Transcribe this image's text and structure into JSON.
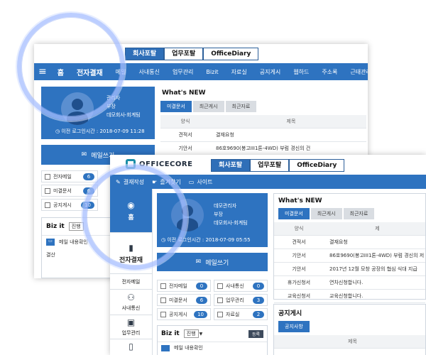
{
  "back": {
    "tabs": [
      "회사포탈",
      "업무포탈",
      "OfficeDiary"
    ],
    "menu_icon": "hamburger-icon",
    "nav_home": "홈",
    "nav_approval": "전자결재",
    "nav": [
      "메일",
      "사내통신",
      "업무관리",
      "Bizit",
      "자료실",
      "공지게시",
      "웹하드",
      "주소록",
      "근태관리",
      "일"
    ],
    "profile": {
      "name": "관리자",
      "position": "부장",
      "company": "데모회사-회계팀",
      "login": "이전 로그인시간 : 2018-07-09 11:28"
    },
    "mail_button": "메일쓰기",
    "stats": [
      {
        "label": "전자메일",
        "count": "6"
      },
      {
        "label": "미결문서",
        "count": "6"
      },
      {
        "label": "공지게시",
        "count": "10"
      }
    ],
    "bizit": {
      "title": "Biz it",
      "select": "진행",
      "items": [
        "메일 내용확인",
        "결산"
      ]
    },
    "whatsnew": {
      "title": "What's NEW",
      "tabs": [
        "미결문서",
        "최근게시",
        "최근자료"
      ],
      "columns": [
        "양식",
        "제목"
      ],
      "rows": [
        {
          "type": "견적서",
          "title": "결재요청"
        },
        {
          "type": "기안서",
          "title": "86호9690(봉고III1톤-4WD) 부럼 경신의 건"
        }
      ]
    }
  },
  "front": {
    "logo": "OFFICECORE",
    "tabs": [
      "회사포탈",
      "업무포탈",
      "OfficeDiary"
    ],
    "toolbar": [
      "결재작성",
      "즐겨찾기",
      "사이트"
    ],
    "sidebar": [
      {
        "label": "홈",
        "icon": "eye-icon"
      },
      {
        "label": "전자결재",
        "icon": "book-icon"
      },
      {
        "label": "전자메일",
        "icon": "mail-icon"
      },
      {
        "label": "사내통신",
        "icon": "people-icon"
      },
      {
        "label": "업무관리",
        "icon": "briefcase-icon"
      },
      {
        "label": "",
        "icon": "phone-icon"
      }
    ],
    "profile": {
      "name": "데모관리자",
      "position": "부장",
      "company": "데모회사-회계팀",
      "login": "이전 로그인시간 : 2018-07-09 05:55"
    },
    "mail_button": "메일쓰기",
    "stats_left": [
      {
        "label": "전자메일",
        "count": "0"
      },
      {
        "label": "미결문서",
        "count": "6"
      },
      {
        "label": "공지게시",
        "count": "10"
      }
    ],
    "stats_right": [
      {
        "label": "사내통신",
        "count": "0"
      },
      {
        "label": "업무관리",
        "count": "3"
      },
      {
        "label": "자료실",
        "count": "2"
      }
    ],
    "bizit": {
      "title": "Biz it",
      "select": "진행",
      "button": "등록",
      "items": [
        "메일 내용확인"
      ]
    },
    "whatsnew": {
      "title": "What's NEW",
      "tabs": [
        "미결문서",
        "최근게시",
        "최근자료"
      ],
      "columns": [
        "양식",
        "제"
      ],
      "rows": [
        {
          "type": "견적서",
          "title": "결재요청"
        },
        {
          "type": "기안서",
          "title": "86호9690(봉고III1톤-4WD) 부럼 경신의 저"
        },
        {
          "type": "기안서",
          "title": "2017년 12월 모창 공장의 협심 식대 지급"
        },
        {
          "type": "휴가신청서",
          "title": "연차신청합니다."
        },
        {
          "type": "교육신청서",
          "title": "교육신청합니다."
        }
      ]
    },
    "notice": {
      "title": "공지게시",
      "tab": "공지사항",
      "column": "제목"
    }
  },
  "colors": {
    "primary": "#2e73c0",
    "dark": "#1f4f8c",
    "magnifier": "#a5beff"
  }
}
